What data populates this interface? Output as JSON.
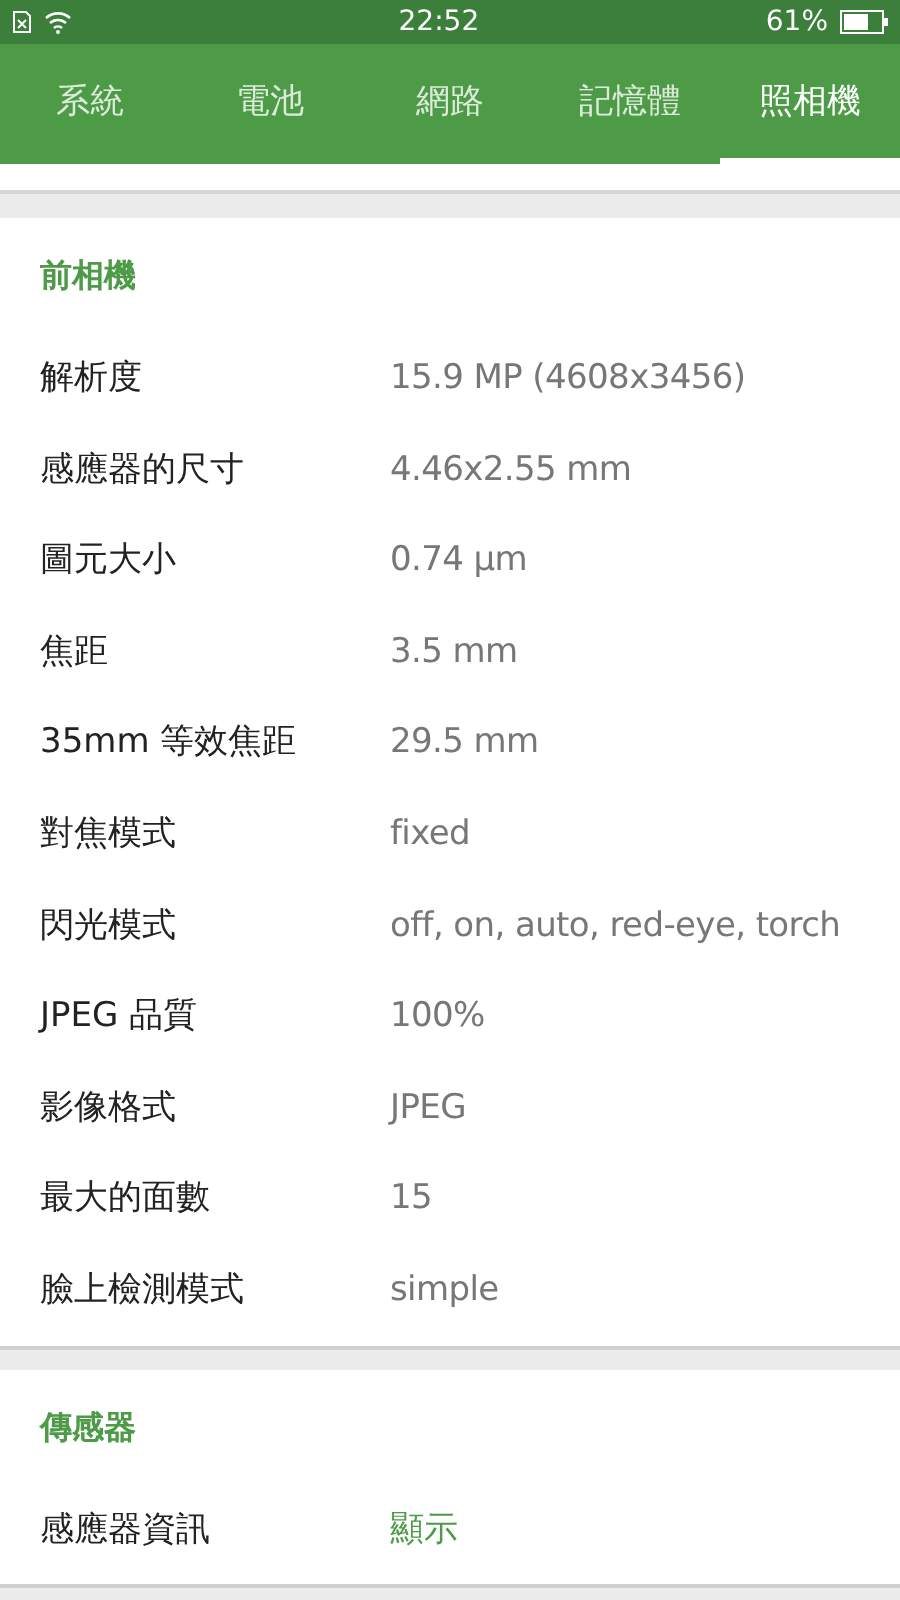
{
  "status_bar": {
    "time": "22:52",
    "battery": "61%"
  },
  "tabs": [
    {
      "label": "系統",
      "selected": false
    },
    {
      "label": "電池",
      "selected": false
    },
    {
      "label": "網路",
      "selected": false
    },
    {
      "label": "記憶體",
      "selected": false
    },
    {
      "label": "照相機",
      "selected": true
    }
  ],
  "sections": [
    {
      "title": "前相機",
      "rows": [
        {
          "label": "解析度",
          "value": "15.9 MP (4608x3456)",
          "kind": "text"
        },
        {
          "label": "感應器的尺寸",
          "value": "4.46x2.55 mm",
          "kind": "text"
        },
        {
          "label": "圖元大小",
          "value": "0.74 µm",
          "kind": "text"
        },
        {
          "label": "焦距",
          "value": "3.5 mm",
          "kind": "text"
        },
        {
          "label": "35mm 等效焦距",
          "value": "29.5 mm",
          "kind": "text"
        },
        {
          "label": "對焦模式",
          "value": "fixed",
          "kind": "text"
        },
        {
          "label": "閃光模式",
          "value": "off, on, auto, red-eye, torch",
          "kind": "text"
        },
        {
          "label": "JPEG 品質",
          "value": "100%",
          "kind": "text"
        },
        {
          "label": "影像格式",
          "value": "JPEG",
          "kind": "text"
        },
        {
          "label": "最大的面數",
          "value": "15",
          "kind": "text"
        },
        {
          "label": "臉上檢測模式",
          "value": "simple",
          "kind": "text"
        }
      ]
    },
    {
      "title": "傳感器",
      "rows": [
        {
          "label": "感應器資訊",
          "value": "顯示",
          "kind": "link"
        }
      ]
    }
  ]
}
